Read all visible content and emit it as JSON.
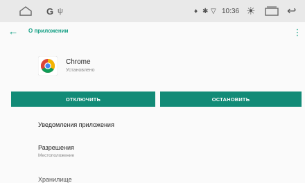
{
  "statusbar": {
    "g_label": "G",
    "signal_glyph": "ψ",
    "location_glyph": "♦",
    "bluetooth_glyph": "✱",
    "wifi_glyph": "▽",
    "time": "10:36",
    "brightness_glyph": "☀",
    "back_glyph": "↩"
  },
  "appbar": {
    "back_glyph": "←",
    "title": "О приложении",
    "menu_glyph": "⋮"
  },
  "app": {
    "name": "Chrome",
    "status": "Установлено",
    "icon": "chrome-logo"
  },
  "buttons": {
    "disable": "ОТКЛЮЧИТЬ",
    "stop": "ОСТАНОВИТЬ"
  },
  "list": {
    "notifications": "Уведомления приложения",
    "permissions_title": "Разрешения",
    "permissions_sub": "Местоположение",
    "storage_partial": "Хранилище"
  },
  "colors": {
    "accent": "#16a085",
    "button": "#128b77",
    "statusbar_bg": "#e9e9e9",
    "background": "#fafafa"
  }
}
